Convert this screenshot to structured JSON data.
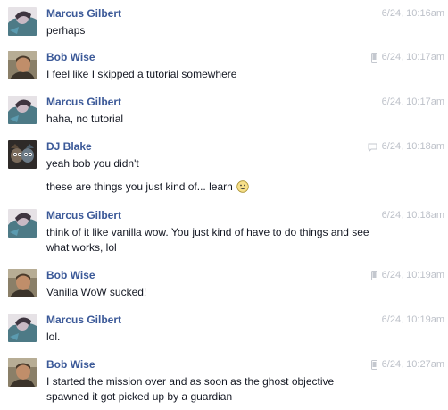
{
  "messages": [
    {
      "sender": "Marcus Gilbert",
      "avatar": "marcus-avatar",
      "device": "",
      "time": "6/24, 10:16am",
      "lines": [
        "perhaps"
      ]
    },
    {
      "sender": "Bob Wise",
      "avatar": "bob-avatar",
      "device": "mobile-icon",
      "time": "6/24, 10:17am",
      "lines": [
        "I feel like I skipped a tutorial somewhere"
      ]
    },
    {
      "sender": "Marcus Gilbert",
      "avatar": "marcus-avatar",
      "device": "",
      "time": "6/24, 10:17am",
      "lines": [
        "haha, no tutorial"
      ]
    },
    {
      "sender": "DJ Blake",
      "avatar": "dj-avatar",
      "device": "chat-icon",
      "time": "6/24, 10:18am",
      "lines": [
        "yeah bob you didn't"
      ],
      "extra": "these are things you just kind of... learn",
      "extra_icon": "smiley-icon"
    },
    {
      "sender": "Marcus Gilbert",
      "avatar": "marcus-avatar",
      "device": "",
      "time": "6/24, 10:18am",
      "lines": [
        "think of it like vanilla wow.  You just kind of have to do things and see",
        "what works, lol"
      ]
    },
    {
      "sender": "Bob Wise",
      "avatar": "bob-avatar",
      "device": "mobile-icon",
      "time": "6/24, 10:19am",
      "lines": [
        "Vanilla WoW sucked!"
      ]
    },
    {
      "sender": "Marcus Gilbert",
      "avatar": "marcus-avatar",
      "device": "",
      "time": "6/24, 10:19am",
      "lines": [
        "lol."
      ]
    },
    {
      "sender": "Bob Wise",
      "avatar": "bob-avatar",
      "device": "mobile-icon",
      "time": "6/24, 10:27am",
      "lines": [
        "I started the mission over and as soon as the ghost objective",
        "spawned it got picked up by a guardian"
      ]
    }
  ]
}
